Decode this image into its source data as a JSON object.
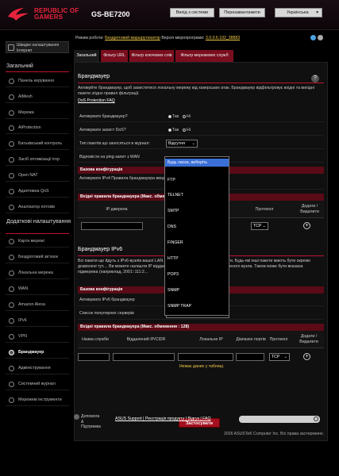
{
  "header": {
    "brand_line1": "REPUBLIC OF",
    "brand_line2": "GAMERS",
    "model": "GS-BE7200",
    "logout_label": "Вихід з системи",
    "reboot_label": "Перезавантажити",
    "language": "Українська"
  },
  "sidebar": {
    "wizard_label": "Швидке налаштування Інтернет",
    "general_title": "Загальний",
    "advanced_title": "Додаткові налаштування",
    "general_items": [
      {
        "label": "Панель керування"
      },
      {
        "label": "AiMesh"
      },
      {
        "label": "Мережа"
      },
      {
        "label": "AiProtection"
      },
      {
        "label": "Батьківський контроль"
      },
      {
        "label": "Засіб оптимізації ігор"
      },
      {
        "label": "Open NAT"
      },
      {
        "label": "Адаптивна QoS"
      },
      {
        "label": "Аналізатор потоків"
      }
    ],
    "advanced_items": [
      {
        "label": "Карта мережі"
      },
      {
        "label": "Бездротовий зв’язок"
      },
      {
        "label": "Локальна мережа"
      },
      {
        "label": "WAN"
      },
      {
        "label": "Amazon Alexa"
      },
      {
        "label": "IPv6"
      },
      {
        "label": "VPN"
      },
      {
        "label": "Брандмауер"
      },
      {
        "label": "Адміністрування"
      },
      {
        "label": "Системний журнал"
      },
      {
        "label": "Мережеві інструменти"
      }
    ]
  },
  "firmware": {
    "mode_prefix": "Режим роботи:",
    "mode_value": "Бездротовий маршрутизатор",
    "version_prefix": "Версія мікропрограми:",
    "version_value": "3.0.0.6.102_38883"
  },
  "tabs": [
    {
      "label": "Загальний"
    },
    {
      "label": "Фільтр URL"
    },
    {
      "label": "Фільтр ключових слів"
    },
    {
      "label": "Фільтр мережевих служб"
    }
  ],
  "firewall": {
    "title": "Брандмауер",
    "desc": "Активуйте брандмауер, щоб захиститися локальну мережу від хакерських атак. Брандмауер відфільтровує вхідні та вихідні пакети згідно правил фільтрації.",
    "dos_link": "DoS Protection FAQ",
    "enable_fw_label": "Активувати брандмауер?",
    "enable_dos_label": "Активувати захист DoS?",
    "log_label": "Тип пакетів що заносяться в журнал:",
    "log_value": "Відсутня",
    "ping_label": "Відповісти на ping-запит з WAN",
    "yes": "Так",
    "no": "Ні"
  },
  "ipv4": {
    "bar": "Базова конфігурація",
    "enable_label": "Активувати IPv4 Правила брандмауера вводу",
    "rules_bar": "Вхідні правила брандмауера (Макс. обмеження : 128)",
    "col_ip": "IP джерела",
    "col_port": "Діапазон портів",
    "col_proto": "Протокол",
    "col_addremove": "Додати / Видалити",
    "proto_value": "TCP"
  },
  "ipv6": {
    "title": "Брандмауер IPv6",
    "desc": "Всі пакети що йдуть з IPv6-вузлів вашої LAN... які і пов’язані з ними вхідні пакети. Будь-які інші пакети мають бути окремо дозволені тут.... Ви можете налашти IP віддаленого вузла т... Будь-якого віддаленого вузла. Також може бути вказана підмережа (наприклад, 2001::111:2...",
    "bar": "Базова конфігурація",
    "enable_label": "Активувати IPv6 брандмауер",
    "services_label": "Список популярних серверів",
    "services_value": "Будь ласка, виберіть",
    "rules_bar": "Вхідні правила брандмауера (Макс. обмеження : 128)",
    "col_service": "Назва служби",
    "col_remote": "Віддалений IP/CIDR",
    "col_local": "Локальне IP",
    "col_port": "Діапазон портів",
    "col_proto": "Протокол",
    "col_addremove": "Додати / Видалити",
    "proto_value": "TCP",
    "empty_text": "Немає даних у таблиці.",
    "apply_label": "Застосувати"
  },
  "dropdown": {
    "options": [
      {
        "label": "Будь ласка, виберіть"
      },
      {
        "label": "FTP"
      },
      {
        "label": "TELNET"
      },
      {
        "label": "SMTP"
      },
      {
        "label": "DNS"
      },
      {
        "label": "FINGER"
      },
      {
        "label": "HTTP"
      },
      {
        "label": "POP3"
      },
      {
        "label": "SNMP"
      },
      {
        "label": "SNMP TRAP"
      }
    ]
  },
  "footer": {
    "help_label": "Допомога & Підтримка",
    "links": "ASUS Support | Реєстрація продукту | Відгук | FAQ",
    "copyright": "2026 ASUSTeK Computer Inc. Всі права застережені."
  },
  "colors": {
    "accent": "#c0142e",
    "brand": "#e8243c",
    "dropdown_highlight": "#3a6fd8"
  }
}
